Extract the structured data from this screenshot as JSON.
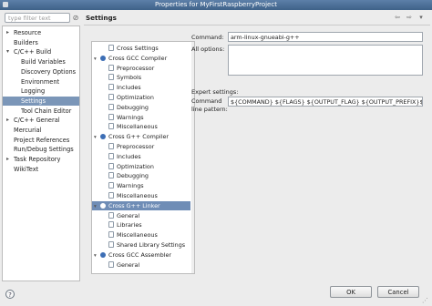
{
  "window": {
    "title": "Properties for MyFirstRaspberryProject"
  },
  "left_panel": {
    "filter_placeholder": "type filter text",
    "items": [
      {
        "label": "Resource",
        "expandable": true
      },
      {
        "label": "Builders"
      },
      {
        "label": "C/C++ Build",
        "expanded": true
      },
      {
        "label": "Build Variables"
      },
      {
        "label": "Discovery Options"
      },
      {
        "label": "Environment"
      },
      {
        "label": "Logging"
      },
      {
        "label": "Settings",
        "selected": true
      },
      {
        "label": "Tool Chain Editor"
      },
      {
        "label": "C/C++ General",
        "expandable": true
      },
      {
        "label": "Mercurial"
      },
      {
        "label": "Project References"
      },
      {
        "label": "Run/Debug Settings"
      },
      {
        "label": "Task Repository",
        "expandable": true
      },
      {
        "label": "WikiText"
      }
    ]
  },
  "right_panel": {
    "title": "Settings",
    "tool_tree": [
      {
        "label": "Cross Settings",
        "level": 1,
        "icon": "category"
      },
      {
        "label": "Cross GCC Compiler",
        "level": 0,
        "icon": "tool",
        "expanded": true
      },
      {
        "label": "Preprocessor",
        "level": 1,
        "icon": "category"
      },
      {
        "label": "Symbols",
        "level": 1,
        "icon": "category"
      },
      {
        "label": "Includes",
        "level": 1,
        "icon": "category"
      },
      {
        "label": "Optimization",
        "level": 1,
        "icon": "category"
      },
      {
        "label": "Debugging",
        "level": 1,
        "icon": "category"
      },
      {
        "label": "Warnings",
        "level": 1,
        "icon": "category"
      },
      {
        "label": "Miscellaneous",
        "level": 1,
        "icon": "category"
      },
      {
        "label": "Cross G++ Compiler",
        "level": 0,
        "icon": "tool",
        "expanded": true
      },
      {
        "label": "Preprocessor",
        "level": 1,
        "icon": "category"
      },
      {
        "label": "Includes",
        "level": 1,
        "icon": "category"
      },
      {
        "label": "Optimization",
        "level": 1,
        "icon": "category"
      },
      {
        "label": "Debugging",
        "level": 1,
        "icon": "category"
      },
      {
        "label": "Warnings",
        "level": 1,
        "icon": "category"
      },
      {
        "label": "Miscellaneous",
        "level": 1,
        "icon": "category"
      },
      {
        "label": "Cross G++ Linker",
        "level": 0,
        "icon": "tool",
        "expanded": true,
        "selected": true
      },
      {
        "label": "General",
        "level": 1,
        "icon": "category"
      },
      {
        "label": "Libraries",
        "level": 1,
        "icon": "category"
      },
      {
        "label": "Miscellaneous",
        "level": 1,
        "icon": "category"
      },
      {
        "label": "Shared Library Settings",
        "level": 1,
        "icon": "category"
      },
      {
        "label": "Cross GCC Assembler",
        "level": 0,
        "icon": "tool",
        "expanded": true
      },
      {
        "label": "General",
        "level": 1,
        "icon": "category"
      }
    ],
    "command_label": "Command:",
    "command_value": "arm-linux-gnueabi-g++",
    "all_options_label": "All options:",
    "all_options_value": "",
    "expert_label": "Expert settings:",
    "pattern_label_line1": "Command",
    "pattern_label_line2": "line pattern:",
    "pattern_value": "${COMMAND} ${FLAGS} ${OUTPUT_FLAG} ${OUTPUT_PREFIX}${"
  },
  "buttons": {
    "ok": "OK",
    "cancel": "Cancel"
  }
}
